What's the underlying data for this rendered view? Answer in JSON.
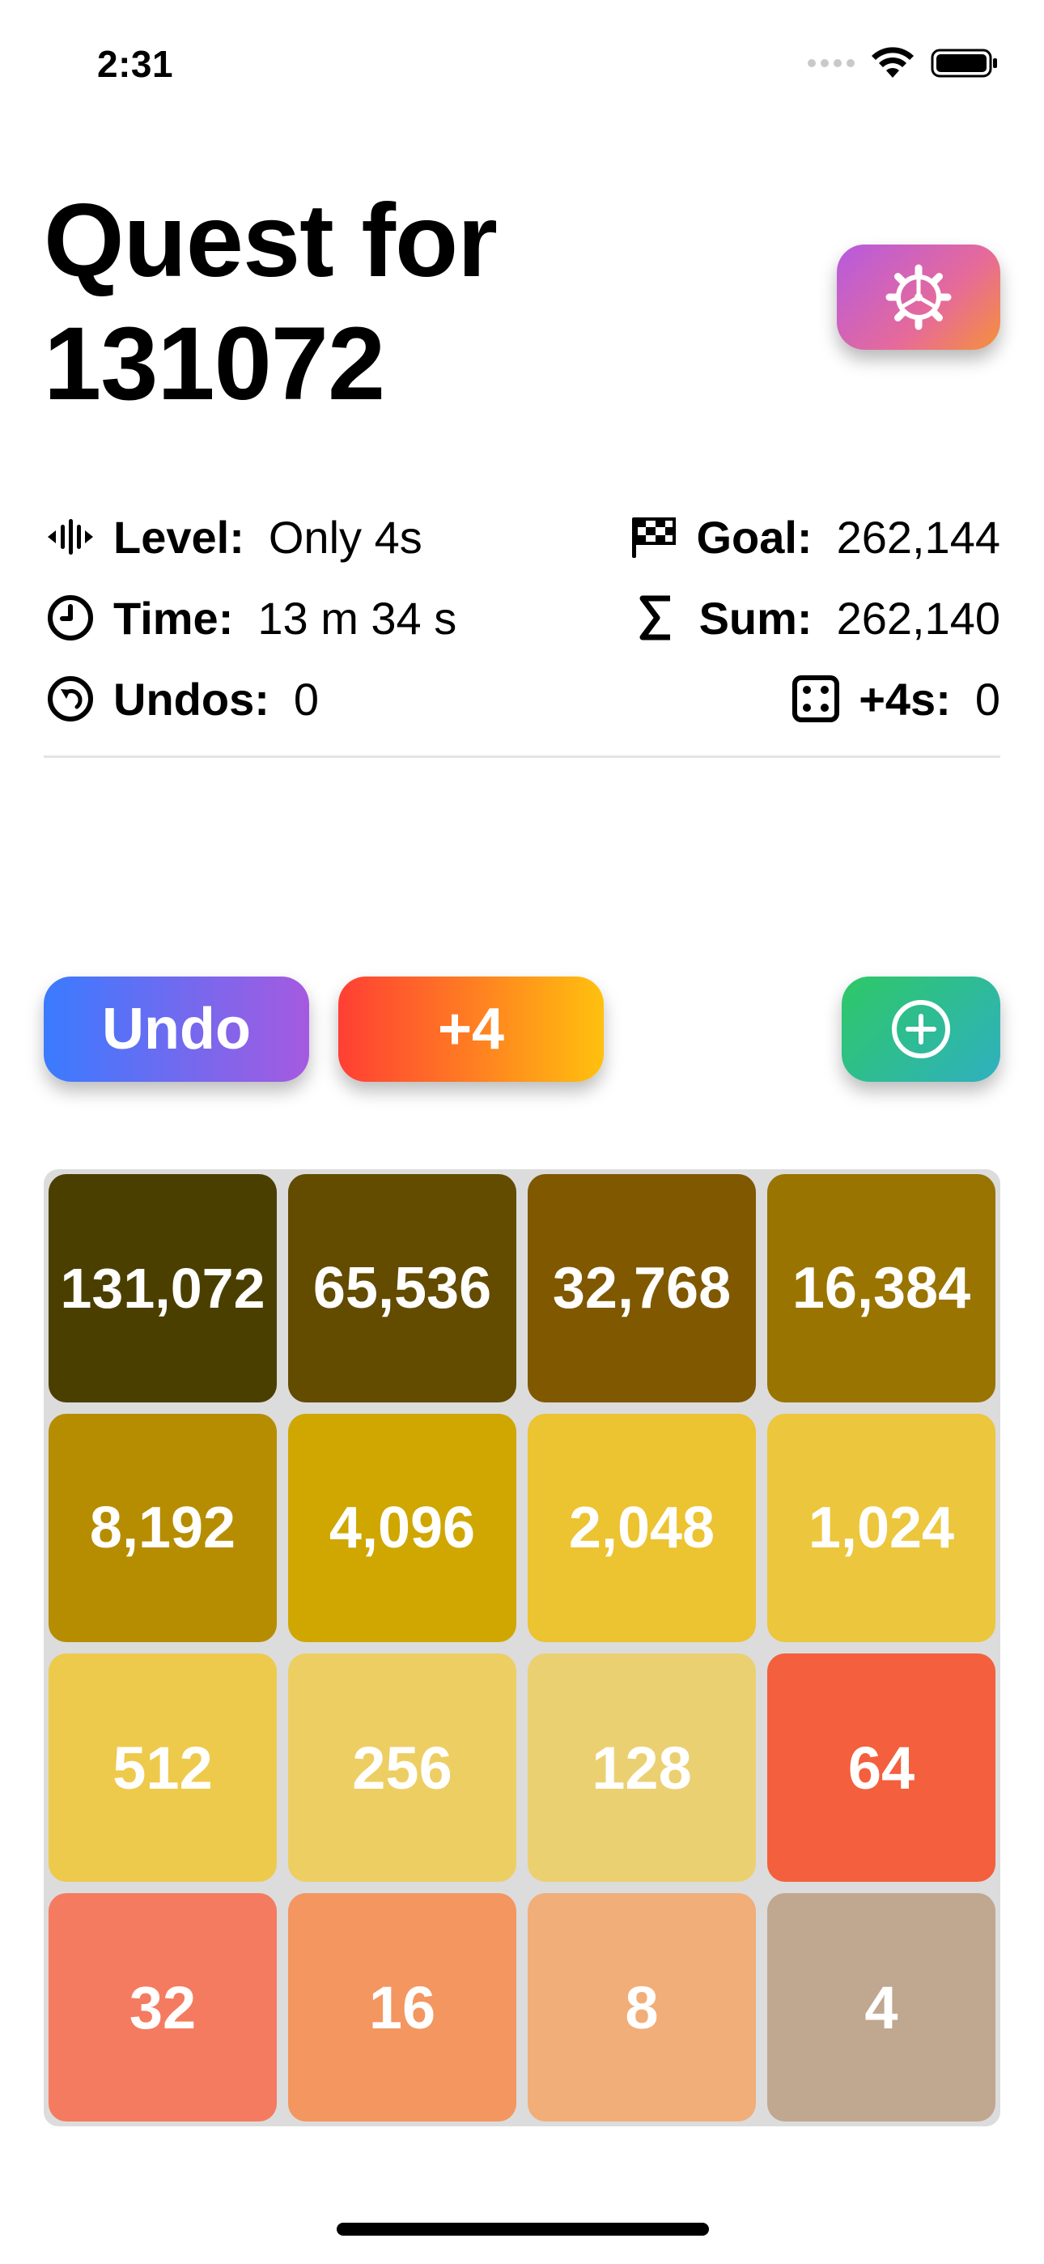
{
  "status_bar": {
    "time": "2:31"
  },
  "title": {
    "line1": "Quest for",
    "line2": "131072"
  },
  "stats": {
    "level": {
      "label": "Level:",
      "value": "Only 4s"
    },
    "time": {
      "label": "Time:",
      "value": "13 m 34 s"
    },
    "undos": {
      "label": "Undos:",
      "value": "0"
    },
    "goal": {
      "label": "Goal:",
      "value": "262,144"
    },
    "sum": {
      "label": "Sum:",
      "value": "262,140"
    },
    "plus4s": {
      "label": "+4s:",
      "value": "0"
    }
  },
  "buttons": {
    "undo": "Undo",
    "plus4": "+4"
  },
  "board": {
    "tiles": [
      {
        "value": "131,072",
        "color": "#4b3f00"
      },
      {
        "value": "65,536",
        "color": "#634b00"
      },
      {
        "value": "32,768",
        "color": "#805800"
      },
      {
        "value": "16,384",
        "color": "#9a7400"
      },
      {
        "value": "8,192",
        "color": "#b68d00"
      },
      {
        "value": "4,096",
        "color": "#cfa700"
      },
      {
        "value": "2,048",
        "color": "#ecc330"
      },
      {
        "value": "1,024",
        "color": "#ecc63c"
      },
      {
        "value": "512",
        "color": "#edca4c"
      },
      {
        "value": "256",
        "color": "#edce63"
      },
      {
        "value": "128",
        "color": "#ebd072"
      },
      {
        "value": "64",
        "color": "#f45f3d"
      },
      {
        "value": "32",
        "color": "#f57b60"
      },
      {
        "value": "16",
        "color": "#f39660"
      },
      {
        "value": "8",
        "color": "#f1ae79"
      },
      {
        "value": "4",
        "color": "#c0a78f"
      }
    ]
  },
  "icons": {
    "level": "waveform-icon",
    "time": "clock-icon",
    "undos": "undo-arrow-icon",
    "goal": "checkered-flag-icon",
    "sum": "sigma-icon",
    "plus4s": "dice-icon",
    "settings": "gear-icon",
    "new_game": "plus-circle-icon"
  }
}
